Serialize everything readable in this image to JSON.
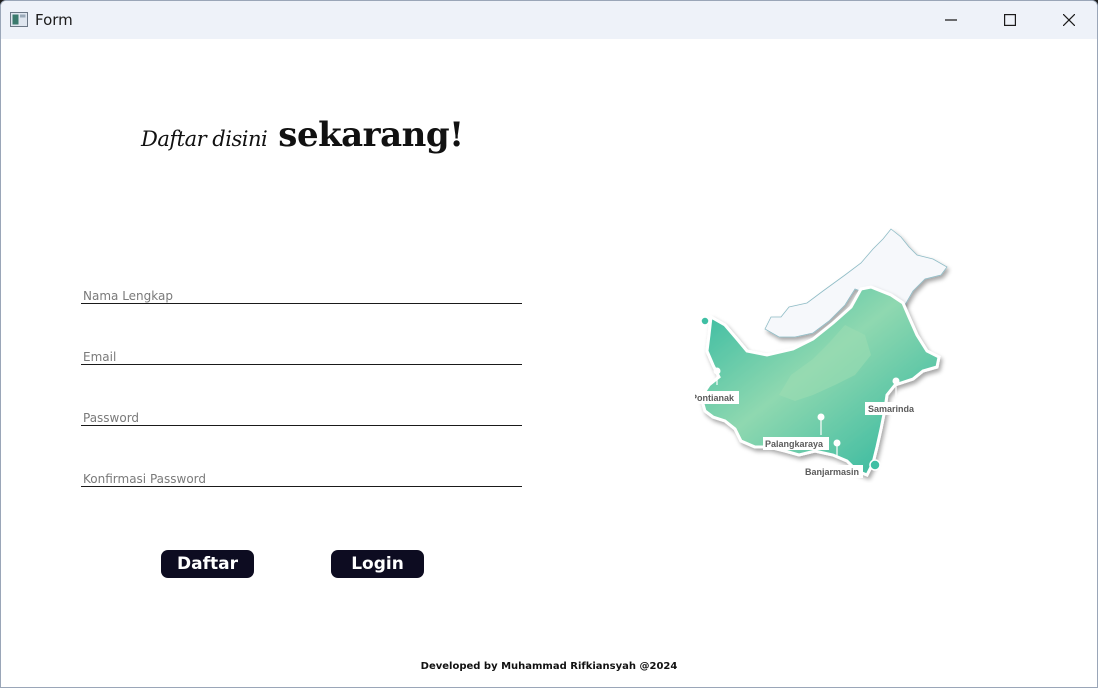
{
  "window": {
    "title": "Form",
    "icon": "form-app-icon"
  },
  "controls": {
    "minimize_icon": "minimize-icon",
    "maximize_icon": "maximize-icon",
    "close_icon": "close-icon"
  },
  "heading": {
    "prefix": "Daftar disini",
    "emphasis": "sekarang!"
  },
  "form": {
    "full_name": {
      "placeholder": "Nama Lengkap",
      "value": ""
    },
    "email": {
      "placeholder": "Email",
      "value": ""
    },
    "password": {
      "placeholder": "Password",
      "value": ""
    },
    "confirm_password": {
      "placeholder": "Konfirmasi Password",
      "value": ""
    }
  },
  "buttons": {
    "register": "Daftar",
    "login": "Login"
  },
  "map": {
    "cities": [
      "Pontianak",
      "Samarinda",
      "Palangkaraya",
      "Banjarmasin"
    ],
    "colors": {
      "land": "#3fbfa4",
      "land_highlight": "#8fd8b0",
      "north": "#f6f8fb",
      "pin": "#ffffff"
    }
  },
  "footer": {
    "credit": "Developed by Muhammad Rifkiansyah @2024"
  },
  "colors": {
    "button_bg": "#0d0c21",
    "button_text": "#ffffff",
    "titlebar_bg": "#eef2f9"
  }
}
